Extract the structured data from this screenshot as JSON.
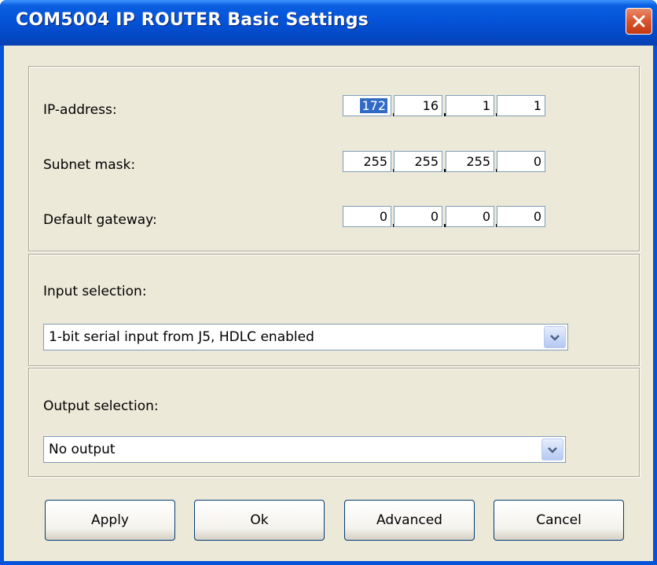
{
  "window": {
    "title": "COM5004 IP ROUTER Basic Settings",
    "close_icon": "close-icon"
  },
  "network": {
    "ip_label": "IP-address:",
    "ip_octets": [
      "172",
      "16",
      "1",
      "1"
    ],
    "subnet_label": "Subnet mask:",
    "subnet_octets": [
      "255",
      "255",
      "255",
      "0"
    ],
    "gateway_label": "Default gateway:",
    "gateway_octets": [
      "0",
      "0",
      "0",
      "0"
    ]
  },
  "input": {
    "label": "Input selection:",
    "value": "1-bit serial input from J5, HDLC enabled"
  },
  "output": {
    "label": "Output selection:",
    "value": "No output"
  },
  "buttons": {
    "apply": "Apply",
    "ok": "Ok",
    "advanced": "Advanced",
    "cancel": "Cancel"
  },
  "colors": {
    "titlebar": "#0553d8",
    "close_button": "#d9542c",
    "dialog_bg": "#ece9d8",
    "selection": "#316ac5"
  }
}
